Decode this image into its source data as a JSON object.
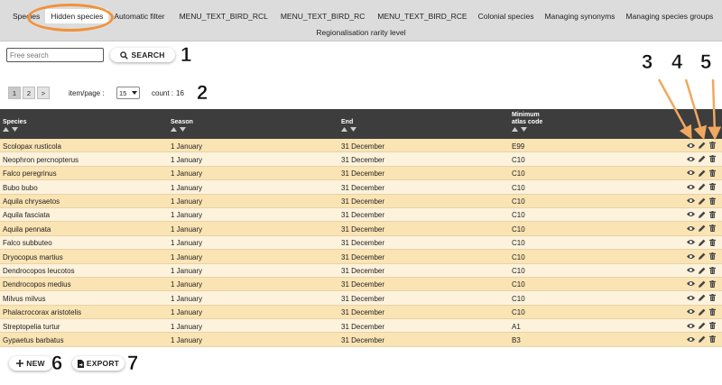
{
  "nav": {
    "tabs": [
      "Species",
      "Hidden species",
      "Automatic filter",
      "MENU_TEXT_BIRD_RCL",
      "MENU_TEXT_BIRD_RC",
      "MENU_TEXT_BIRD_RCE",
      "Colonial species",
      "Managing synonyms",
      "Managing species groups"
    ],
    "tabs_row2": [
      "Regionalisation rarity level"
    ],
    "active_tab": "Hidden species"
  },
  "search": {
    "placeholder": "Free search",
    "button_label": "SEARCH"
  },
  "pagination": {
    "pages": [
      "1",
      "2",
      ">"
    ],
    "current_page": "1",
    "items_per_page_label": "item/page :",
    "items_per_page_value": "15",
    "count_label": "count :",
    "count_value": "16"
  },
  "table": {
    "headers": {
      "species": "Species",
      "season": "Season",
      "end": "End",
      "code_line1": "Minimum",
      "code_line2": "atlas code"
    },
    "rows": [
      {
        "species": "Scolopax rusticola",
        "season": "1 January",
        "end": "31 December",
        "code": "E99"
      },
      {
        "species": "Neophron percnopterus",
        "season": "1 January",
        "end": "31 December",
        "code": "C10"
      },
      {
        "species": "Falco peregrinus",
        "season": "1 January",
        "end": "31 December",
        "code": "C10"
      },
      {
        "species": "Bubo bubo",
        "season": "1 January",
        "end": "31 December",
        "code": "C10"
      },
      {
        "species": "Aquila chrysaetos",
        "season": "1 January",
        "end": "31 December",
        "code": "C10"
      },
      {
        "species": "Aquila fasciata",
        "season": "1 January",
        "end": "31 December",
        "code": "C10"
      },
      {
        "species": "Aquila pennata",
        "season": "1 January",
        "end": "31 December",
        "code": "C10"
      },
      {
        "species": "Falco subbuteo",
        "season": "1 January",
        "end": "31 December",
        "code": "C10"
      },
      {
        "species": "Dryocopus martius",
        "season": "1 January",
        "end": "31 December",
        "code": "C10"
      },
      {
        "species": "Dendrocopos leucotos",
        "season": "1 January",
        "end": "31 December",
        "code": "C10"
      },
      {
        "species": "Dendrocopos medius",
        "season": "1 January",
        "end": "31 December",
        "code": "C10"
      },
      {
        "species": "Milvus milvus",
        "season": "1 January",
        "end": "31 December",
        "code": "C10"
      },
      {
        "species": "Phalacrocorax aristotelis",
        "season": "1 January",
        "end": "31 December",
        "code": "C10"
      },
      {
        "species": "Streptopelia turtur",
        "season": "1 January",
        "end": "31 December",
        "code": "A1"
      },
      {
        "species": "Gypaetus barbatus",
        "season": "1 January",
        "end": "31 December",
        "code": "B3"
      }
    ],
    "row_action_icons": [
      "eye-icon",
      "pencil-icon",
      "trash-icon"
    ]
  },
  "footer": {
    "new_label": "NEW",
    "export_label": "EXPORT"
  },
  "callouts": [
    "1",
    "2",
    "3",
    "4",
    "5",
    "6",
    "7"
  ],
  "colors": {
    "nav_bg": "#dcdcdc",
    "header_bg": "#3d3d3d",
    "row_odd": "#fbe4b4",
    "row_even": "#fdf2dc",
    "highlight": "#f0923a"
  }
}
